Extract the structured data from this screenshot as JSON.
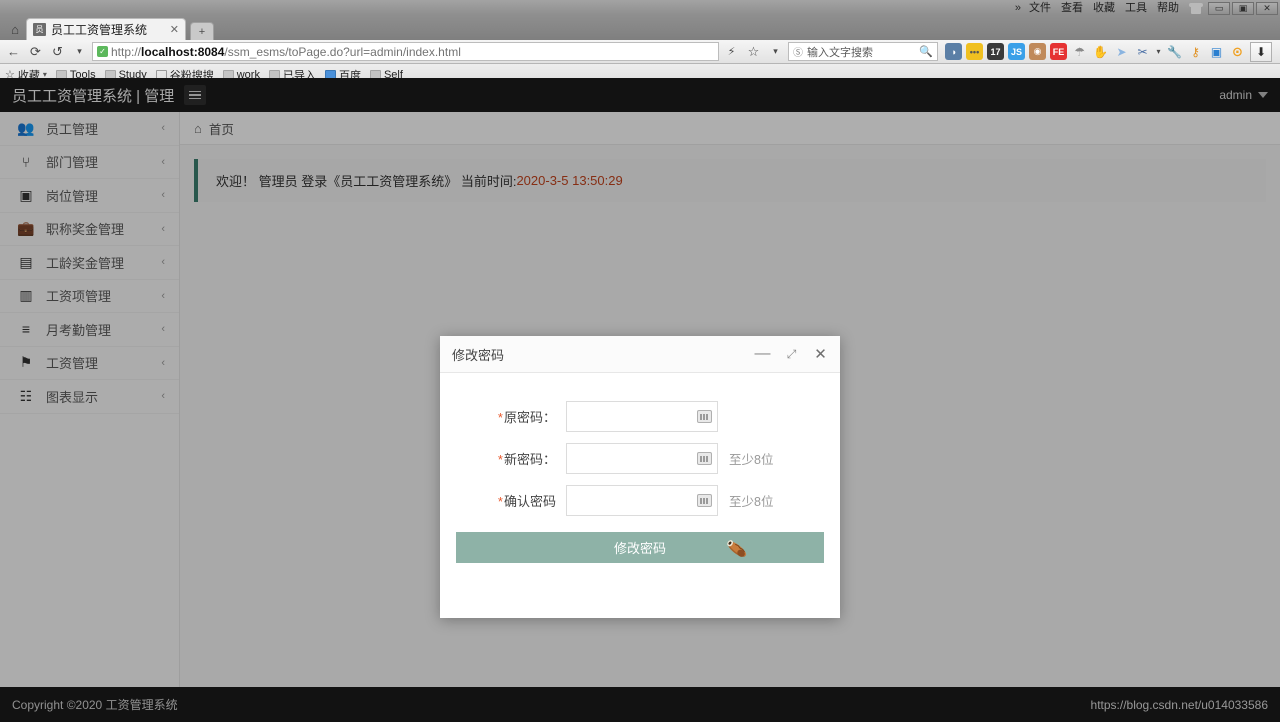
{
  "browser": {
    "window_menu": [
      "文件",
      "查看",
      "收藏",
      "工具",
      "帮助"
    ],
    "menu_overflow": "»",
    "window_controls": {
      "minimize": "—",
      "maximize": "❐",
      "close": "✕"
    },
    "tab": {
      "title": "员工工资管理系统",
      "favicon": "app-favicon",
      "close": "✕"
    },
    "new_tab": "+",
    "nav": {
      "back": "←",
      "reload": "⟳",
      "history": "↺",
      "history_caret": "▾"
    },
    "url": {
      "scheme": "http://",
      "host": "localhost:8084",
      "path": "/ssm_esms/toPage.do?url=admin/index.html",
      "secure_badge": "✓"
    },
    "url_right": {
      "lightning": "⚡",
      "star": "☆",
      "caret": "▾"
    },
    "search": {
      "placeholder": "输入文字搜索",
      "engine_icon": "Ⓢ",
      "magnifier": "search-icon"
    },
    "extensions": [
      {
        "name": "opera-icon",
        "glyph": "◑",
        "color": "#5b7fa6"
      },
      {
        "name": "notes-icon",
        "glyph": "•••",
        "color": "#f0c020"
      },
      {
        "name": "counter-17-icon",
        "glyph": "17",
        "color": "#3a3a3a"
      },
      {
        "name": "js-icon",
        "glyph": "JS",
        "color": "#3aa0e8"
      },
      {
        "name": "monkey-icon",
        "glyph": "●",
        "color": "#c08a5a"
      },
      {
        "name": "fe-icon",
        "glyph": "FE",
        "color": "#e53232"
      },
      {
        "name": "parachute-icon",
        "glyph": "☂",
        "color": "#9a9a9a"
      },
      {
        "name": "hand-icon",
        "glyph": "✋",
        "color": "#4a7fd0"
      },
      {
        "name": "pointer-icon",
        "glyph": "➤",
        "color": "#7fa8d8"
      },
      {
        "name": "scissors-icon",
        "glyph": "✂",
        "color": "#4a6fa5"
      },
      {
        "name": "scissors-caret",
        "glyph": "▾",
        "color": "#4a4a4a"
      },
      {
        "name": "wrench-icon",
        "glyph": "🔧",
        "color": "#3a6fc0"
      },
      {
        "name": "key-icon",
        "glyph": "⚷",
        "color": "#e09020"
      },
      {
        "name": "zoom-doc-icon",
        "glyph": "▣",
        "color": "#2a7fd0"
      },
      {
        "name": "more-icon",
        "glyph": "⋯",
        "color": "#f0a020"
      }
    ],
    "download_button": "⬇",
    "bookmarks": [
      {
        "label": "收藏",
        "icon": "star-icon",
        "caret": "▾"
      },
      {
        "label": "Tools",
        "icon": "folder-icon"
      },
      {
        "label": "Study",
        "icon": "folder-icon"
      },
      {
        "label": "谷粉搜搜",
        "icon": "bookmark-outline-icon"
      },
      {
        "label": "work",
        "icon": "folder-icon"
      },
      {
        "label": "已导入",
        "icon": "folder-icon"
      },
      {
        "label": "百度",
        "icon": "baidu-icon"
      },
      {
        "label": "Self",
        "icon": "folder-icon"
      }
    ]
  },
  "app": {
    "header": {
      "brand": "员工工资管理系统 | 管理",
      "menu_toggle": "hamburger-icon",
      "user": "admin"
    },
    "sidebar": {
      "items": [
        {
          "label": "员工管理",
          "icon": "users-icon",
          "glyph": "👥",
          "chevron": "‹"
        },
        {
          "label": "部门管理",
          "icon": "sitemap-icon",
          "glyph": "⑂",
          "chevron": "‹"
        },
        {
          "label": "岗位管理",
          "icon": "badge-icon",
          "glyph": "▣",
          "chevron": "‹"
        },
        {
          "label": "职称奖金管理",
          "icon": "briefcase-icon",
          "glyph": "💼",
          "chevron": "‹"
        },
        {
          "label": "工龄奖金管理",
          "icon": "cash-register-icon",
          "glyph": "▤",
          "chevron": "‹"
        },
        {
          "label": "工资项管理",
          "icon": "money-window-icon",
          "glyph": "▥",
          "chevron": "‹"
        },
        {
          "label": "月考勤管理",
          "icon": "layers-icon",
          "glyph": "≡",
          "chevron": "‹"
        },
        {
          "label": "工资管理",
          "icon": "tag-icon",
          "glyph": "⚑",
          "chevron": "‹"
        },
        {
          "label": "图表显示",
          "icon": "chart-book-icon",
          "glyph": "☷",
          "chevron": "‹"
        }
      ]
    },
    "breadcrumb": {
      "home_icon": "home-icon",
      "label": "首页"
    },
    "welcome": {
      "text": "欢迎！ 管理员 登录《员工工资管理系统》 当前时间:",
      "timestamp": "2020-3-5 13:50:29"
    },
    "footer": {
      "copyright": "Copyright ©2020 工资管理系统",
      "watermark": "https://blog.csdn.net/u014033586"
    }
  },
  "modal": {
    "title": "修改密码",
    "controls": {
      "minimize": "—",
      "maximize": "⤢",
      "close": "✕"
    },
    "fields": [
      {
        "required": "*",
        "label": "原密码：",
        "value": "",
        "placeholder": "",
        "hint": "",
        "icon": "keyboard-icon"
      },
      {
        "required": "*",
        "label": "新密码：",
        "value": "",
        "placeholder": "",
        "hint": "至少8位",
        "icon": "keyboard-icon"
      },
      {
        "required": "*",
        "label": "确认密码",
        "value": "",
        "placeholder": "",
        "hint": "至少8位",
        "icon": "keyboard-icon"
      }
    ],
    "submit_label": "修改密码"
  },
  "colors": {
    "accent_green": "#8eb2a7",
    "welcome_bar": "#3a7d6d",
    "timestamp": "#c1431d",
    "required_star": "#e8582c",
    "header_dark": "#1b1b1b"
  }
}
